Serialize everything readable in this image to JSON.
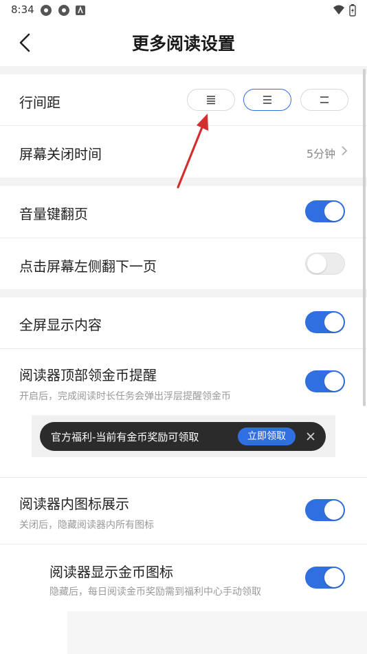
{
  "status_bar": {
    "time": "8:34"
  },
  "header": {
    "title": "更多阅读设置"
  },
  "line_spacing": {
    "label": "行间距",
    "options": [
      {
        "icon": "spacing-dense-icon",
        "active": false
      },
      {
        "icon": "spacing-medium-icon",
        "active": true
      },
      {
        "icon": "spacing-wide-icon",
        "active": false
      }
    ]
  },
  "screen_timeout": {
    "label": "屏幕关闭时间",
    "value": "5分钟"
  },
  "volume_key_flip": {
    "label": "音量键翻页",
    "on": true
  },
  "tap_left_next": {
    "label": "点击屏幕左侧翻下一页",
    "on": false
  },
  "fullscreen": {
    "label": "全屏显示内容",
    "on": true
  },
  "coin_reminder": {
    "label": "阅读器顶部领金币提醒",
    "desc": "开启后，完成阅读时长任务会弹出浮层提醒领金币",
    "on": true
  },
  "banner": {
    "text": "官方福利-当前有金币奖励可领取",
    "button": "立即领取"
  },
  "icon_display": {
    "label": "阅读器内图标展示",
    "desc": "关闭后，隐藏阅读器内所有图标",
    "on": true
  },
  "coin_icon": {
    "label": "阅读器显示金币图标",
    "desc": "隐藏后，每日阅读金币奖励需到福利中心手动领取",
    "on": true
  },
  "colors": {
    "accent": "#2f6fe0",
    "banner_bg": "#2b2b2b",
    "annotation_arrow": "#d32f2f"
  }
}
